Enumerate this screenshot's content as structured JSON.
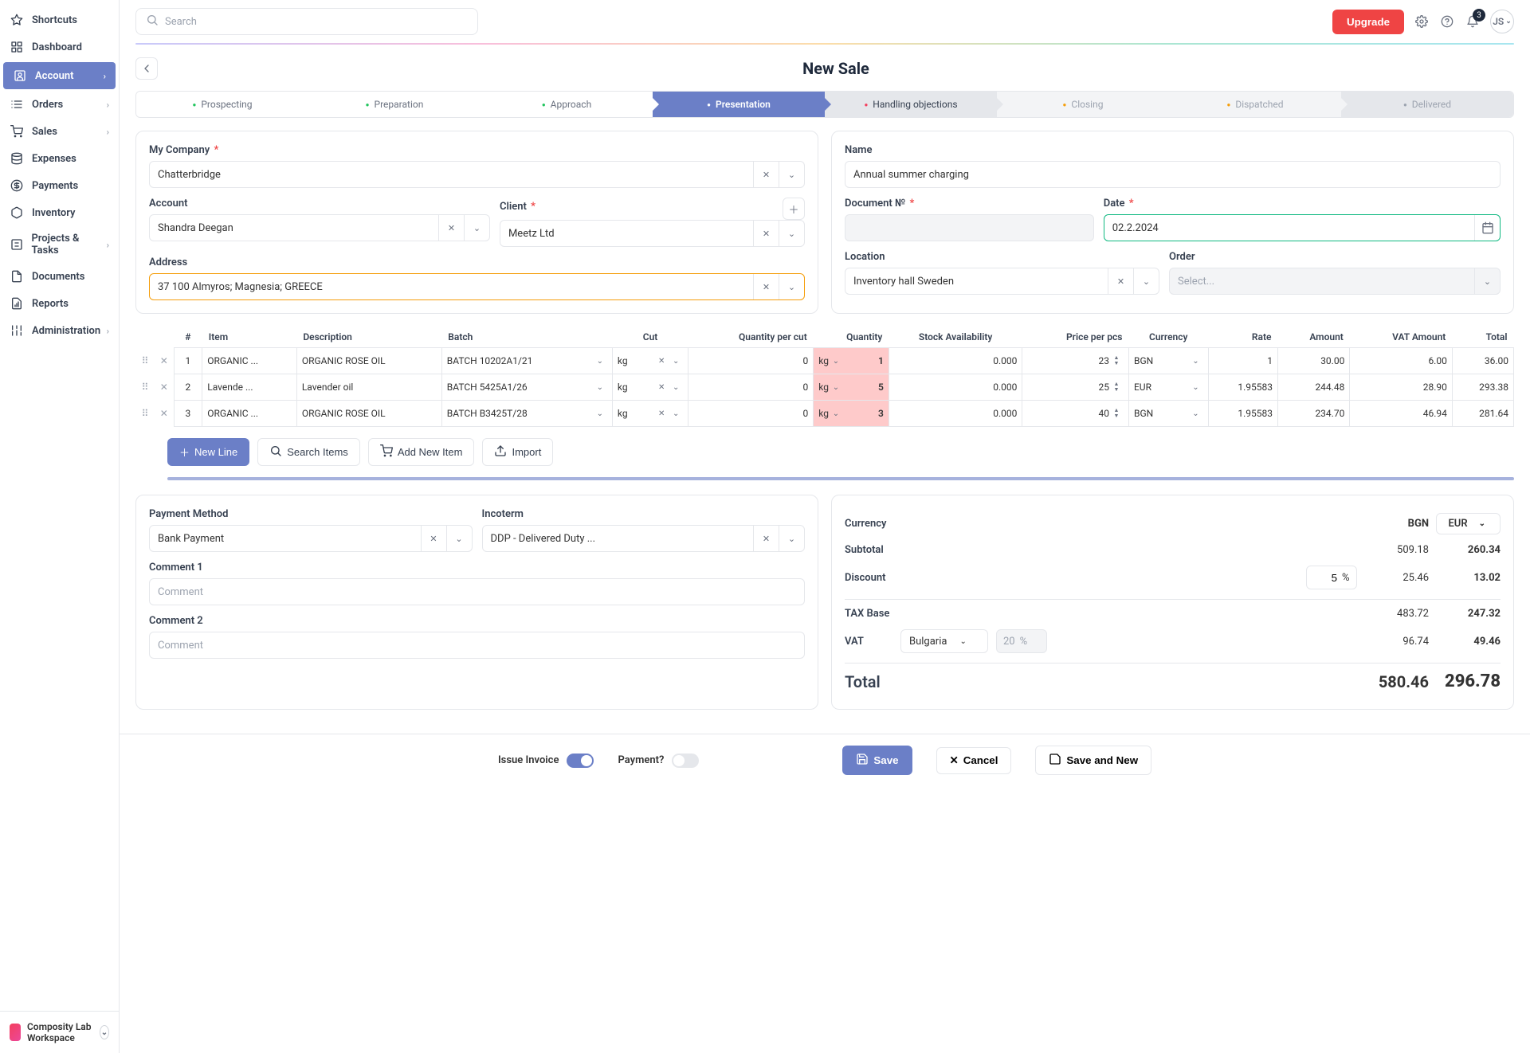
{
  "topbar": {
    "search_placeholder": "Search",
    "upgrade": "Upgrade",
    "notifications": "3",
    "avatar": "JS"
  },
  "sidebar": {
    "items": [
      {
        "label": "Shortcuts",
        "icon": "star"
      },
      {
        "label": "Dashboard",
        "icon": "grid"
      },
      {
        "label": "Account",
        "icon": "user",
        "active": true,
        "chev": true
      },
      {
        "label": "Orders",
        "icon": "list",
        "chev": true
      },
      {
        "label": "Sales",
        "icon": "cart",
        "chev": true
      },
      {
        "label": "Expenses",
        "icon": "db"
      },
      {
        "label": "Payments",
        "icon": "coin"
      },
      {
        "label": "Inventory",
        "icon": "box"
      },
      {
        "label": "Projects & Tasks",
        "icon": "proj",
        "chev": true
      },
      {
        "label": "Documents",
        "icon": "doc"
      },
      {
        "label": "Reports",
        "icon": "report"
      },
      {
        "label": "Administration",
        "icon": "sliders",
        "chev": true
      }
    ],
    "footer": "Composity Lab Workspace"
  },
  "page_title": "New Sale",
  "steps": [
    "Prospecting",
    "Preparation",
    "Approach",
    "Presentation",
    "Handling objections",
    "Closing",
    "Dispatched",
    "Delivered"
  ],
  "left_panel": {
    "my_company_label": "My Company",
    "my_company_value": "Chatterbridge",
    "account_label": "Account",
    "account_value": "Shandra Deegan",
    "client_label": "Client",
    "client_value": "Meetz Ltd",
    "address_label": "Address",
    "address_value": "37 100 Almyros; Magnesia; GREECE"
  },
  "right_panel": {
    "name_label": "Name",
    "name_value": "Annual summer charging",
    "doc_label": "Document №",
    "date_label": "Date",
    "date_value": "02.2.2024",
    "location_label": "Location",
    "location_value": "Inventory hall Sweden",
    "order_label": "Order",
    "order_placeholder": "Select..."
  },
  "table": {
    "headers": [
      "#",
      "Item",
      "Description",
      "Batch",
      "Cut",
      "Quantity per cut",
      "Quantity",
      "Stock Availability",
      "Price per pcs",
      "Currency",
      "Rate",
      "Amount",
      "VAT Amount",
      "Total"
    ],
    "rows": [
      {
        "n": "1",
        "item": "ORGANIC ...",
        "desc": "ORGANIC ROSE OIL",
        "batch": "BATCH 10202A1/21",
        "cut_unit": "kg",
        "qpc": "0",
        "qty_unit": "kg",
        "qty": "1",
        "stock": "0.000",
        "price": "23",
        "cur": "BGN",
        "rate": "1",
        "amount": "30.00",
        "vat": "6.00",
        "total": "36.00"
      },
      {
        "n": "2",
        "item": "Lavende ...",
        "desc": "Lavender oil",
        "batch": "BATCH 5425A1/26",
        "cut_unit": "kg",
        "qpc": "0",
        "qty_unit": "kg",
        "qty": "5",
        "stock": "0.000",
        "price": "25",
        "cur": "EUR",
        "rate": "1.95583",
        "amount": "244.48",
        "vat": "28.90",
        "total": "293.38"
      },
      {
        "n": "3",
        "item": "ORGANIC ...",
        "desc": "ORGANIC ROSE OIL",
        "batch": "BATCH B3425T/28",
        "cut_unit": "kg",
        "qpc": "0",
        "qty_unit": "kg",
        "qty": "3",
        "stock": "0.000",
        "price": "40",
        "cur": "BGN",
        "rate": "1.95583",
        "amount": "234.70",
        "vat": "46.94",
        "total": "281.64"
      }
    ]
  },
  "table_actions": {
    "new_line": "New Line",
    "search_items": "Search Items",
    "add_new_item": "Add New Item",
    "import": "Import"
  },
  "payment": {
    "method_label": "Payment Method",
    "method_value": "Bank Payment",
    "incoterm_label": "Incoterm",
    "incoterm_value": "DDP - Delivered Duty ...",
    "comment1_label": "Comment 1",
    "comment2_label": "Comment 2",
    "comment_placeholder": "Comment"
  },
  "totals": {
    "currency_label": "Currency",
    "currency_main": "BGN",
    "currency_switch": "EUR",
    "subtotal_label": "Subtotal",
    "subtotal_a": "509.18",
    "subtotal_b": "260.34",
    "discount_label": "Discount",
    "discount_pct": "5",
    "discount_a": "25.46",
    "discount_b": "13.02",
    "tax_base_label": "TAX Base",
    "tax_base_a": "483.72",
    "tax_base_b": "247.32",
    "vat_label": "VAT",
    "vat_country": "Bulgaria",
    "vat_pct": "20",
    "vat_a": "96.74",
    "vat_b": "49.46",
    "total_label": "Total",
    "total_a": "580.46",
    "total_b": "296.78"
  },
  "footer": {
    "issue_invoice": "Issue Invoice",
    "payment_q": "Payment?",
    "save": "Save",
    "cancel": "Cancel",
    "save_new": "Save and New"
  }
}
